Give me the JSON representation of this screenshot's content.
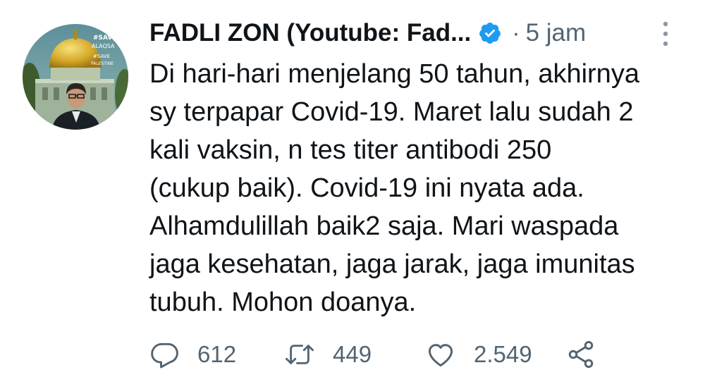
{
  "user": {
    "display_name": "FADLI ZON (Youtube: Fad...",
    "verified": true,
    "separator": "·",
    "time": "5 jam",
    "avatar_text": [
      "#SAVE",
      "ALAQSA",
      "#SAVE",
      "PALESTINE"
    ]
  },
  "tweet": {
    "lines": [
      "Di hari-hari menjelang 50 tahun, akhirnya",
      "sy terpapar Covid-19. Maret lalu sudah 2",
      "kali vaksin, n tes titer antibodi 250",
      "(cukup baik). Covid-19 ini nyata ada.",
      "Alhamdulillah baik2 saja. Mari waspada",
      "jaga kesehatan, jaga jarak, jaga imunitas",
      "tubuh. Mohon doanya."
    ]
  },
  "actions": {
    "replies": "612",
    "retweets": "449",
    "likes": "2.549"
  },
  "colors": {
    "text": "#0f1419",
    "muted": "#536471",
    "verified": "#1d9bf0"
  },
  "icons": [
    "more-vertical-icon",
    "verified-badge-icon",
    "reply-icon",
    "retweet-icon",
    "like-icon",
    "share-icon"
  ]
}
